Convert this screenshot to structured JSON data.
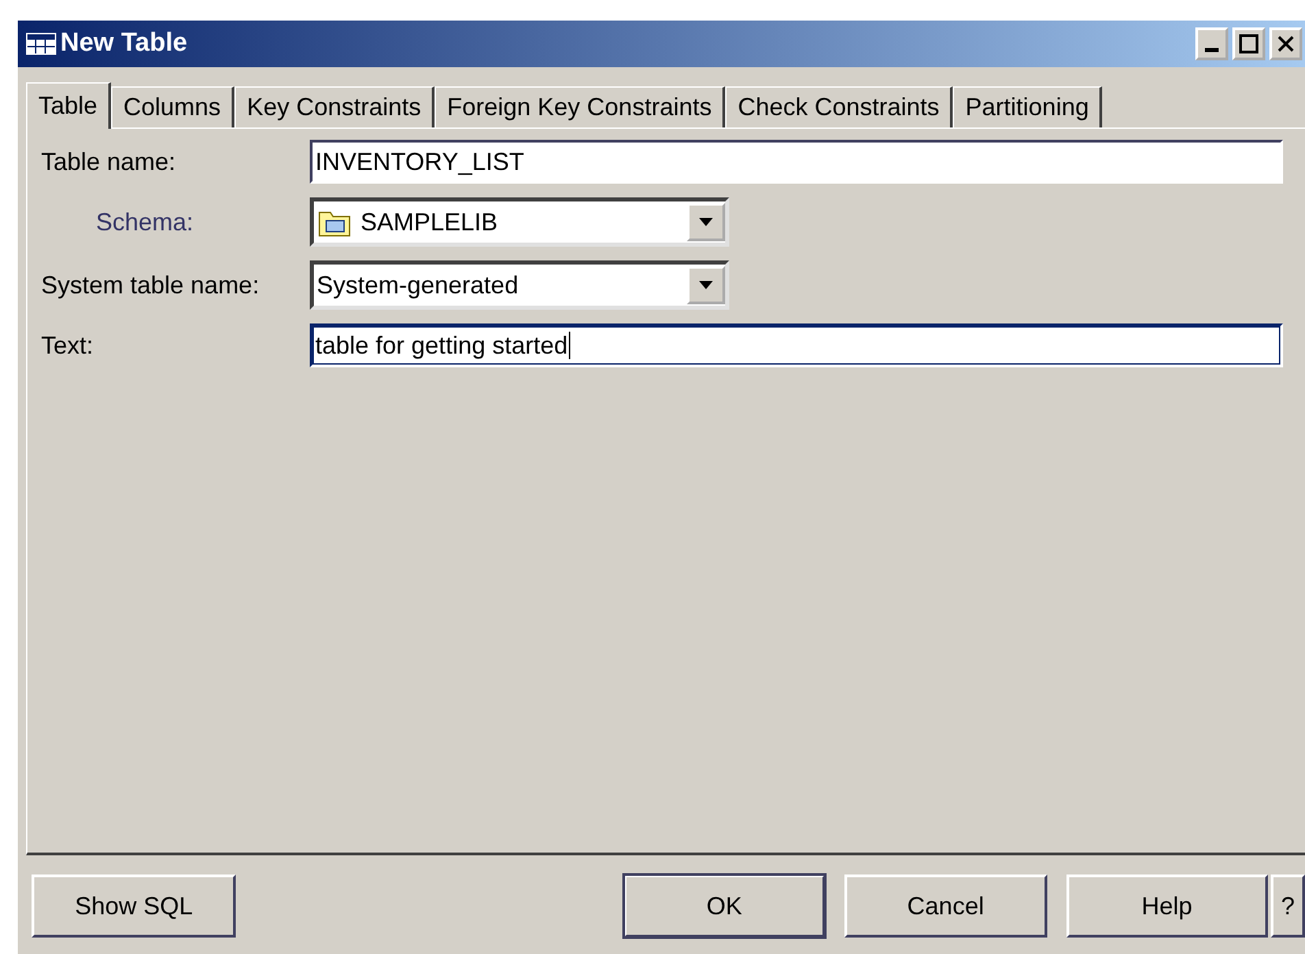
{
  "window": {
    "title": "New Table"
  },
  "tabs": [
    {
      "label": "Table",
      "selected": true
    },
    {
      "label": "Columns",
      "selected": false
    },
    {
      "label": "Key Constraints",
      "selected": false
    },
    {
      "label": "Foreign Key Constraints",
      "selected": false
    },
    {
      "label": "Check Constraints",
      "selected": false
    },
    {
      "label": "Partitioning",
      "selected": false
    }
  ],
  "fields": [
    {
      "kind": "text",
      "label": "Table name:",
      "value": "INVENTORY_LIST",
      "focused": false
    },
    {
      "kind": "library-combo",
      "label": "Schema:",
      "value": "SAMPLELIB"
    },
    {
      "kind": "combo",
      "label": "System table name:",
      "value": "System-generated"
    },
    {
      "kind": "text",
      "label": "Text:",
      "value": "table for getting started",
      "focused": true
    }
  ],
  "buttons": [
    {
      "label": "Show SQL",
      "default": false,
      "kind": "left"
    },
    {
      "label": "OK",
      "default": true,
      "kind": "right"
    },
    {
      "label": "Cancel",
      "default": false,
      "kind": "right"
    },
    {
      "label": "Help",
      "default": false,
      "kind": "right"
    },
    {
      "label": "?",
      "default": false,
      "kind": "small"
    }
  ]
}
